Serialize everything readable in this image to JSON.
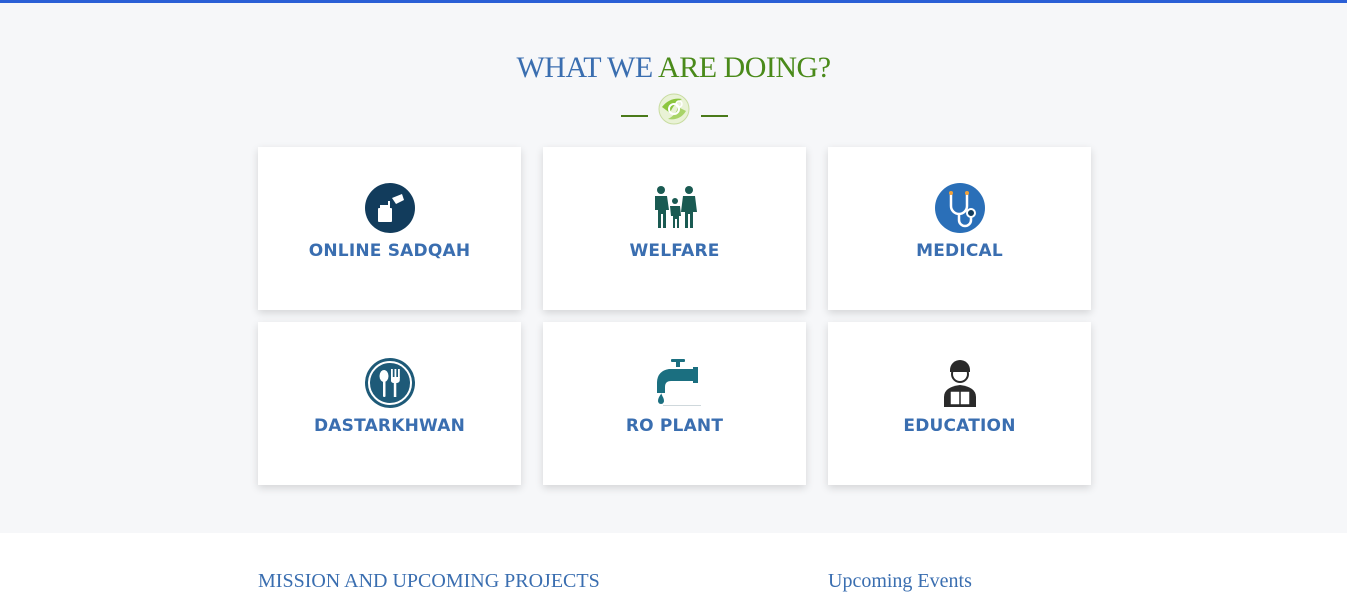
{
  "header": {
    "title_part1": "WHAT WE",
    "title_part2": "ARE DOING?"
  },
  "colors": {
    "accent_blue": "#3a6eb0",
    "accent_green": "#4a8a1a",
    "top_border": "#2b5fd6"
  },
  "services": [
    {
      "label": "ONLINE SADQAH",
      "icon": "donation-icon"
    },
    {
      "label": "WELFARE",
      "icon": "family-icon"
    },
    {
      "label": "MEDICAL",
      "icon": "stethoscope-icon"
    },
    {
      "label": "DASTARKHWAN",
      "icon": "spoon-fork-icon"
    },
    {
      "label": "RO PLANT",
      "icon": "water-tap-icon"
    },
    {
      "label": "EDUCATION",
      "icon": "student-reading-icon"
    }
  ],
  "lower": {
    "mission_title": "MISSION AND UPCOMING PROJECTS",
    "events_title": "Upcoming Events"
  }
}
